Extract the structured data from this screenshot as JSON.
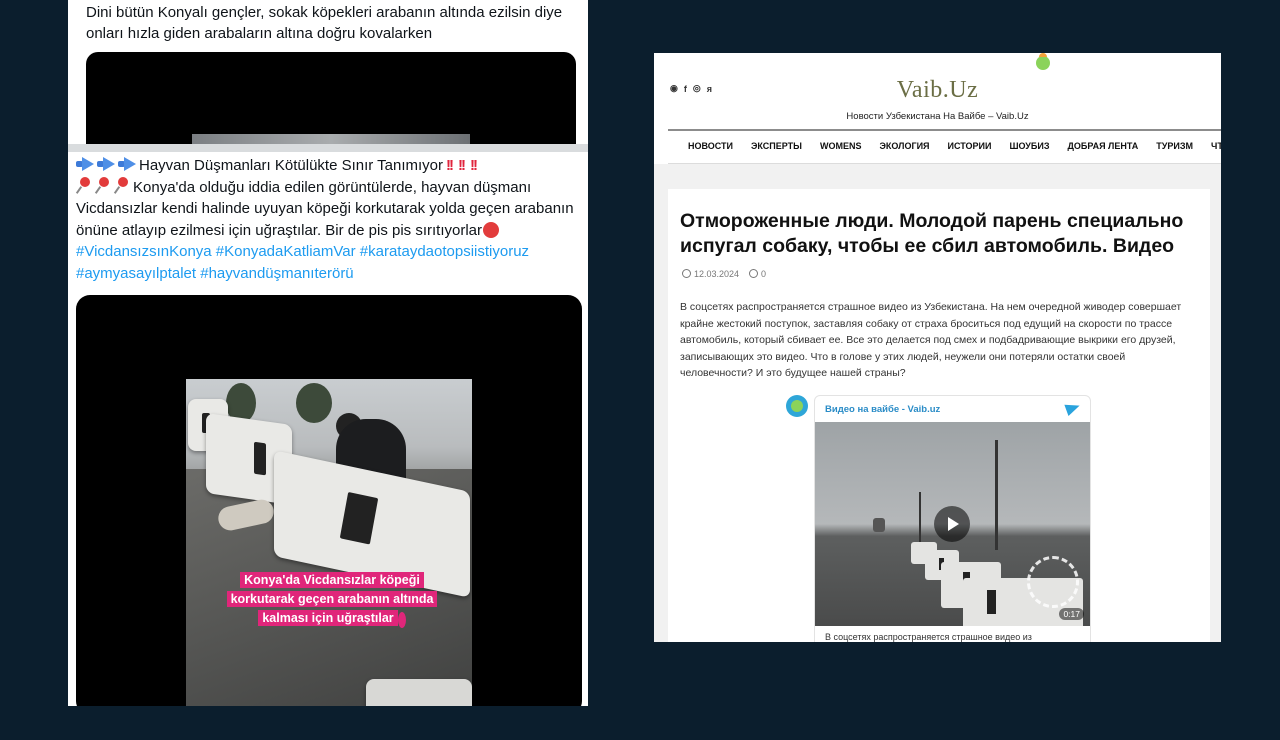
{
  "tweet": {
    "top_text": "Dini bütün Konyalı gençler, sokak köpekleri arabanın altında ezilsin diye onları hızla giden arabaların altına doğru kovalarken",
    "line1": "Hayvan Düşmanları Kötülükte Sınır Tanımıyor",
    "line2_text": "Konya'da olduğu iddia edilen görüntülerde, hayvan düşmanı Vicdansızlar kendi halinde uyuyan köpeği korkutarak yolda geçen arabanın önüne atlayıp ezilmesi için uğraştılar. Bir de pis pis sırıtıyorlar",
    "hashtags": "#VicdansızsınKonya #KonyadaKatliamVar #karataydaotopsiistiyoruz #aymyasayılptalet #hayvandüşmanıterörü",
    "video_caption": "Konya'da Vicdansızlar köpeği korkutarak geçen arabanın altında kalması için uğraştılar"
  },
  "article": {
    "site_name": "Vaib.Uz",
    "tagline": "Новости Узбекистана На Вайбе – Vaib.Uz",
    "social_icons": [
      "telegram-icon",
      "facebook-icon",
      "instagram-icon",
      "yandex-icon"
    ],
    "social_glyphs": [
      "◉",
      "f",
      "◎",
      "я"
    ],
    "nav": [
      "НОВОСТИ",
      "ЭКСПЕРТЫ",
      "WOMENS",
      "ЭКОЛОГИЯ",
      "ИСТОРИИ",
      "ШОУБИЗ",
      "ДОБРАЯ ЛЕНТА",
      "ТУРИЗМ",
      "ЧТО З"
    ],
    "title": "Отмороженные люди. Молодой парень специально испугал собаку, чтобы ее сбил автомобиль. Видео",
    "date": "12.03.2024",
    "comments": "0",
    "body": "В соцсетях распространяется страшное видео из Узбекистана. На нем очередной живодер совершает крайне жестокий поступок, заставляя собаку от страха броситься под едущий на скорости по трассе автомобиль, который сбивает ее. Все это делается под смех и подбадривающие выкрики его друзей, записывающих это видео. Что в голове у этих людей, неужели они потеряли остатки своей человечности? И это будущее нашей страны?",
    "embed": {
      "channel": "Видео на вайбе - Vaib.uz",
      "duration": "0:17",
      "snippet": "В соцсетях распространяется страшное видео из"
    }
  },
  "colors": {
    "background": "#0b1e2d",
    "hashtag": "#1d9bf0",
    "caption_bg": "#e0267a",
    "logo": "#6b6e45",
    "telegram": "#2aa3dd"
  }
}
